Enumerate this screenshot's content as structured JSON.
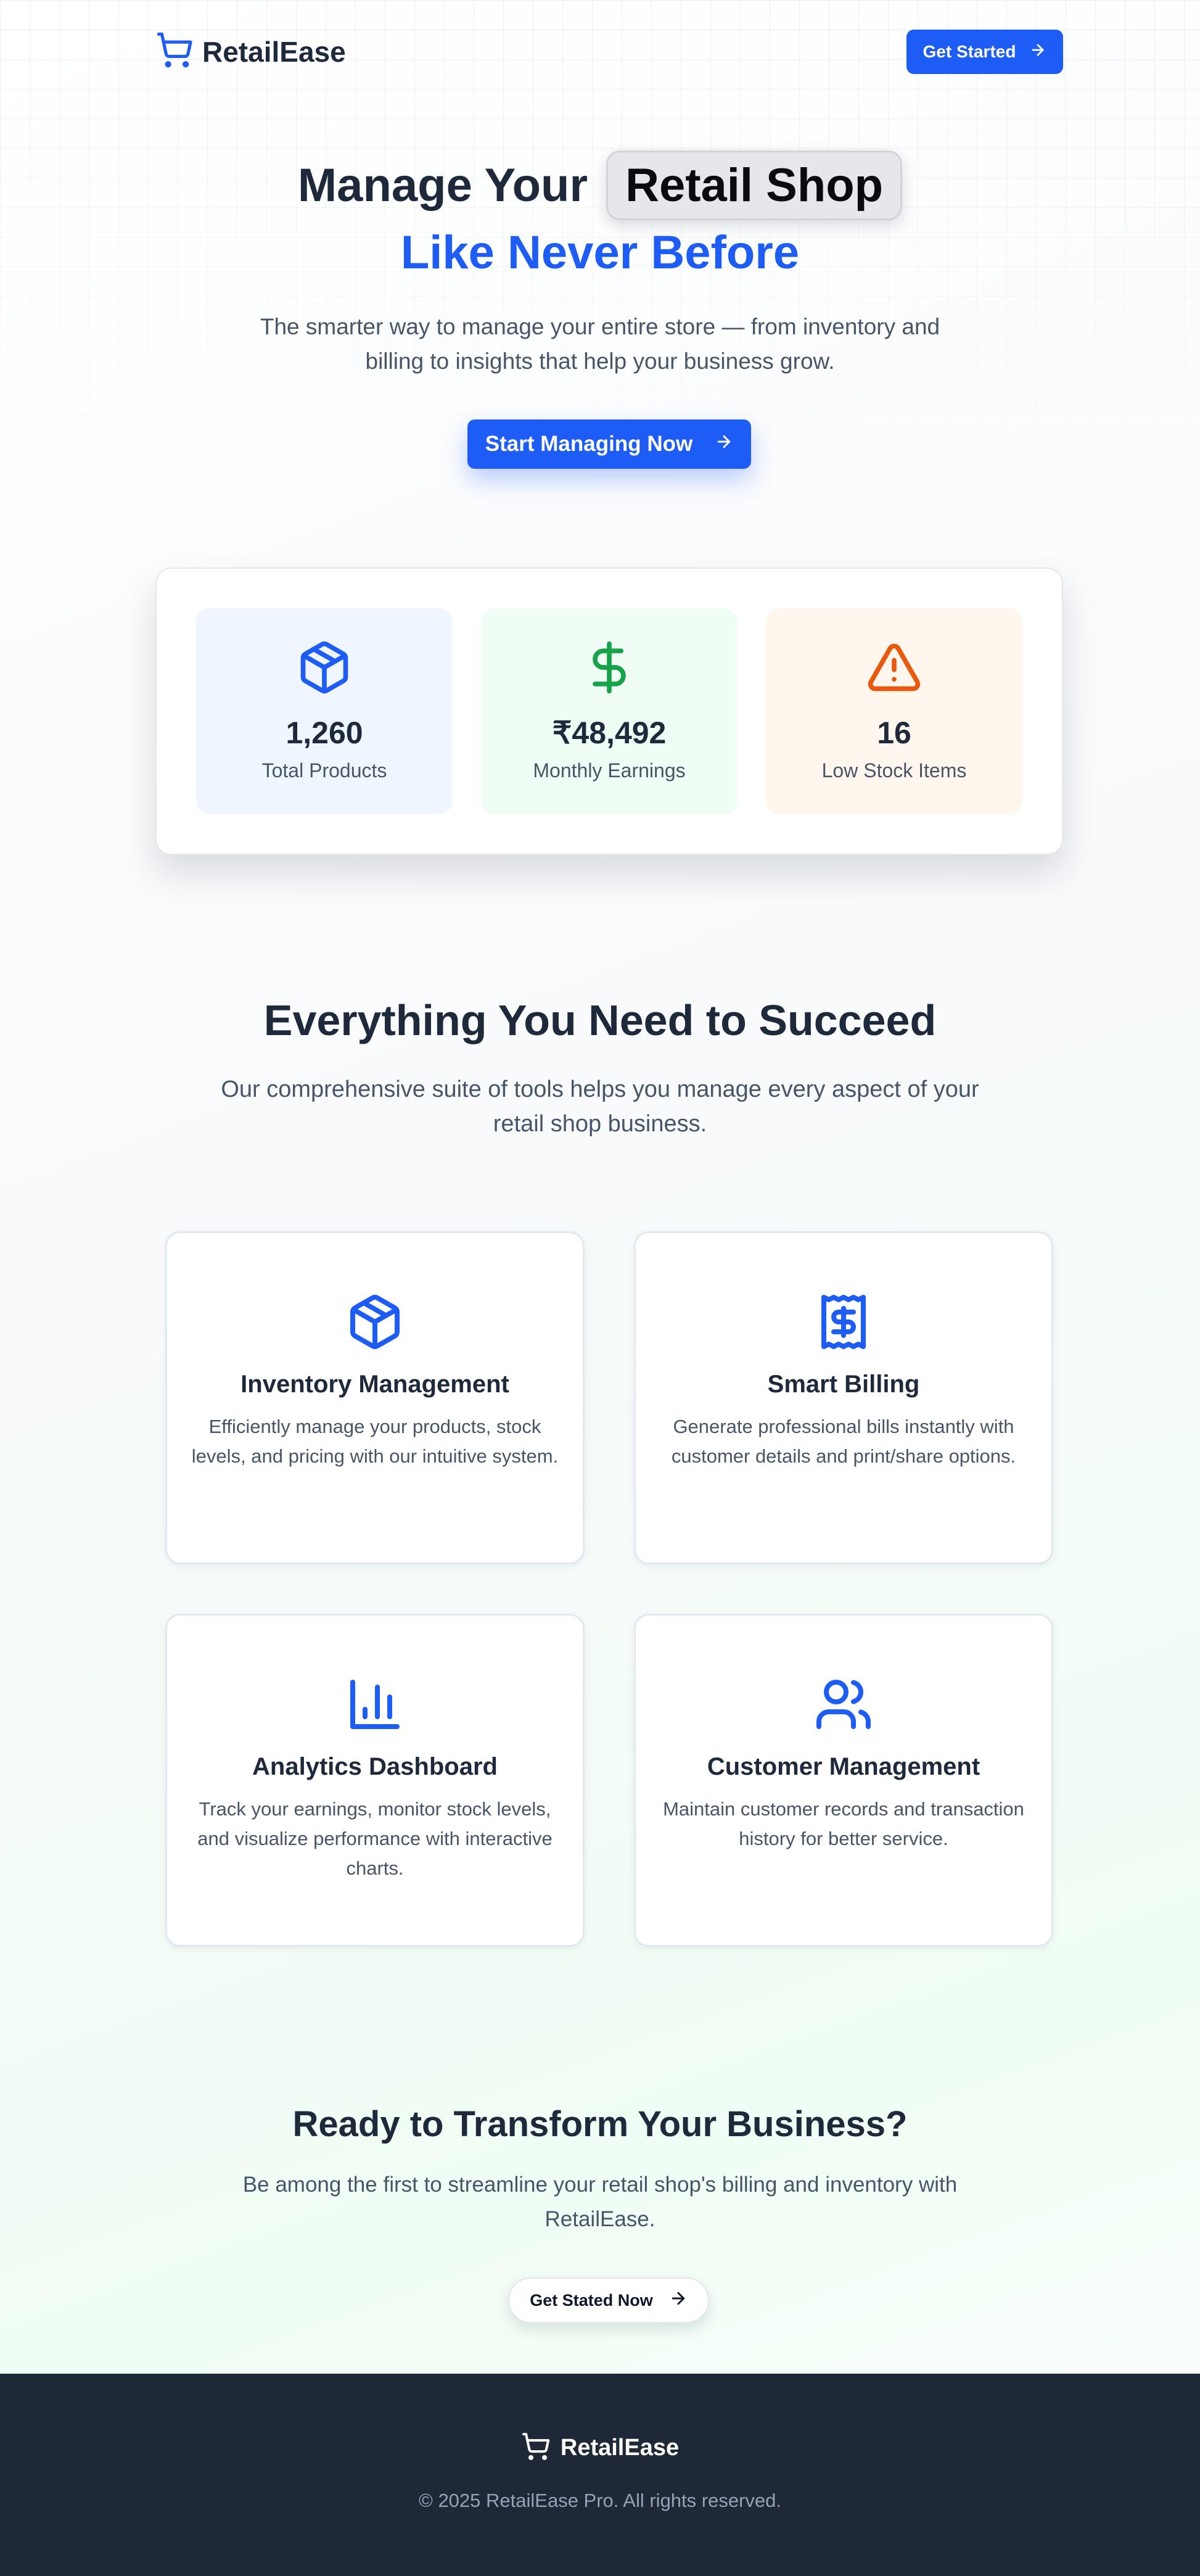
{
  "header": {
    "logo_text": "RetailEase",
    "get_started_label": "Get Started"
  },
  "hero": {
    "title_part1": "Manage Your",
    "title_highlight": "Retail Shop",
    "title_line2": "Like Never Before",
    "subtitle": "The smarter way to manage your entire store — from inventory and billing to insights that help your business grow.",
    "cta_label": "Start Managing Now"
  },
  "stats": [
    {
      "icon": "package-icon",
      "value": "1,260",
      "label": "Total Products",
      "color": "#1d5cf5",
      "bg": "#eff6ff"
    },
    {
      "icon": "dollar-icon",
      "value": "₹48,492",
      "label": "Monthly Earnings",
      "color": "#16a34a",
      "bg": "#f0fdf4"
    },
    {
      "icon": "alert-triangle-icon",
      "value": "16",
      "label": "Low Stock Items",
      "color": "#ea580c",
      "bg": "#fff7ed"
    }
  ],
  "features_section": {
    "title": "Everything You Need to Succeed",
    "subtitle": "Our comprehensive suite of tools helps you manage every aspect of your retail shop business.",
    "items": [
      {
        "icon": "package-icon",
        "title": "Inventory Management",
        "description": "Efficiently manage your products, stock levels, and pricing with our intuitive system."
      },
      {
        "icon": "receipt-icon",
        "title": "Smart Billing",
        "description": "Generate professional bills instantly with customer details and print/share options."
      },
      {
        "icon": "bar-chart-icon",
        "title": "Analytics Dashboard",
        "description": "Track your earnings, monitor stock levels, and visualize performance with interactive charts."
      },
      {
        "icon": "users-icon",
        "title": "Customer Management",
        "description": "Maintain customer records and transaction history for better service."
      }
    ]
  },
  "cta_section": {
    "title": "Ready to Transform Your Business?",
    "subtitle": "Be among the first to streamline your retail shop's billing and inventory with RetailEase.",
    "button_label": "Get Stated Now"
  },
  "footer": {
    "logo_text": "RetailEase",
    "copyright": "© 2025 RetailEase Pro. All rights reserved."
  },
  "colors": {
    "primary": "#1d5cf5",
    "text_dark": "#1e293b",
    "text_muted": "#475569",
    "footer_bg": "#1e2837"
  }
}
